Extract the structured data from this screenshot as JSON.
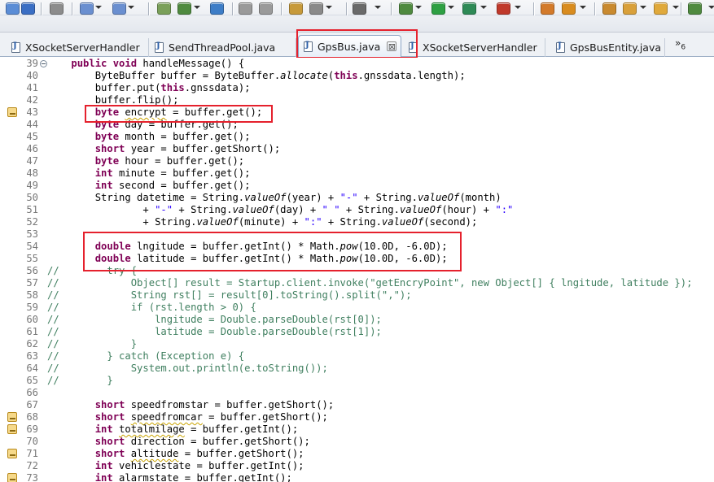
{
  "toolbar": {
    "buttons": [
      {
        "icon": "new-file-icon",
        "color": "#5b8dd6"
      },
      {
        "icon": "save-icon",
        "color": "#3b6fc4"
      },
      {
        "icon": "calendar-icon",
        "color": "#8c8c8c"
      },
      {
        "icon": "hammer-icon",
        "color": "#6a8fd0"
      },
      {
        "icon": "refactor-icon",
        "color": "#6a8fd0"
      },
      {
        "icon": "server-icon",
        "color": "#7aa05a"
      },
      {
        "icon": "deploy-icon",
        "color": "#4f8a3f"
      },
      {
        "icon": "globe-icon",
        "color": "#3d7dc7"
      },
      {
        "icon": "undo-icon",
        "color": "#9a9a9a"
      },
      {
        "icon": "redo-icon",
        "color": "#9a9a9a"
      },
      {
        "icon": "properties-icon",
        "color": "#c79a3a"
      },
      {
        "icon": "web-browser-icon",
        "color": "#8a8a8a"
      },
      {
        "icon": "camera-icon",
        "color": "#6a6a6a"
      },
      {
        "icon": "debug-bug-icon",
        "color": "#4f8a3f"
      },
      {
        "icon": "run-icon",
        "color": "#2ea043"
      },
      {
        "icon": "coverage-icon",
        "color": "#2e8a56"
      },
      {
        "icon": "external-tools-icon",
        "color": "#c0392b"
      },
      {
        "icon": "new-class-icon",
        "color": "#d37a2a"
      },
      {
        "icon": "search-icon",
        "color": "#d98c1f"
      },
      {
        "icon": "open-type-icon",
        "color": "#c98a2f"
      },
      {
        "icon": "edit-pen-icon",
        "color": "#d9a03a"
      },
      {
        "icon": "open-folder-icon",
        "color": "#e0a93b"
      },
      {
        "icon": "pin-icon",
        "color": "#4f8a3f"
      }
    ]
  },
  "tabs": [
    {
      "label": "XSocketServerHandler",
      "active": false
    },
    {
      "label": "SendThreadPool.java",
      "active": false
    },
    {
      "label": "GpsBus.java",
      "active": true,
      "close": "⊠"
    },
    {
      "label": "XSocketServerHandler",
      "active": false
    },
    {
      "label": "GpsBusEntity.java",
      "active": false
    }
  ],
  "tab_overflow": {
    "symbol": "»",
    "count": "6"
  },
  "editor": {
    "lines": [
      {
        "n": "39",
        "fold": true,
        "html": "    <span class=\"kw\">public void</span> handleMessage() {"
      },
      {
        "n": "40",
        "html": "        ByteBuffer buffer = ByteBuffer.<span class=\"ital\">allocate</span>(<span class=\"kw\">this</span>.gnssdata.length);"
      },
      {
        "n": "41",
        "html": "        buffer.put(<span class=\"kw\">this</span>.gnssdata);"
      },
      {
        "n": "42",
        "html": "        buffer.flip();"
      },
      {
        "n": "43",
        "warn": true,
        "html": "        <span class=\"kw\">byte</span> <span class=\"squig\">encrypt</span> = buffer.get();"
      },
      {
        "n": "44",
        "html": "        <span class=\"kw\">byte</span> day = buffer.get();"
      },
      {
        "n": "45",
        "html": "        <span class=\"kw\">byte</span> month = buffer.get();"
      },
      {
        "n": "46",
        "html": "        <span class=\"kw\">short</span> year = buffer.getShort();"
      },
      {
        "n": "47",
        "html": "        <span class=\"kw\">byte</span> hour = buffer.get();"
      },
      {
        "n": "48",
        "html": "        <span class=\"kw\">int</span> minute = buffer.get();"
      },
      {
        "n": "49",
        "html": "        <span class=\"kw\">int</span> second = buffer.get();"
      },
      {
        "n": "50",
        "html": "        String datetime = String.<span class=\"ital\">valueOf</span>(year) + <span class=\"str\">\"-\"</span> + String.<span class=\"ital\">valueOf</span>(month)"
      },
      {
        "n": "51",
        "html": "                + <span class=\"str\">\"-\"</span> + String.<span class=\"ital\">valueOf</span>(day) + <span class=\"str\">\" \"</span> + String.<span class=\"ital\">valueOf</span>(hour) + <span class=\"str\">\":\"</span>"
      },
      {
        "n": "52",
        "html": "                + String.<span class=\"ital\">valueOf</span>(minute) + <span class=\"str\">\":\"</span> + String.<span class=\"ital\">valueOf</span>(second);"
      },
      {
        "n": "53",
        "html": ""
      },
      {
        "n": "54",
        "html": "        <span class=\"kw\">double</span> lngitude = buffer.getInt() * Math.<span class=\"ital\">pow</span>(10.0D, -6.0D);"
      },
      {
        "n": "55",
        "html": "        <span class=\"kw\">double</span> latitude = buffer.getInt() * Math.<span class=\"ital\">pow</span>(10.0D, -6.0D);"
      },
      {
        "n": "56",
        "html": "<span class=\"cm\">//        try {</span>"
      },
      {
        "n": "57",
        "html": "<span class=\"cm\">//            Object[] result = Startup.client.invoke(\"getEncryPoint\", new Object[] { lngitude, latitude });</span>"
      },
      {
        "n": "58",
        "html": "<span class=\"cm\">//            String rst[] = result[0].toString().split(\",\");</span>"
      },
      {
        "n": "59",
        "html": "<span class=\"cm\">//            if (rst.length > 0) {</span>"
      },
      {
        "n": "60",
        "html": "<span class=\"cm\">//                lngitude = Double.parseDouble(rst[0]);</span>"
      },
      {
        "n": "61",
        "html": "<span class=\"cm\">//                latitude = Double.parseDouble(rst[1]);</span>"
      },
      {
        "n": "62",
        "html": "<span class=\"cm\">//            }</span>"
      },
      {
        "n": "63",
        "html": "<span class=\"cm\">//        } catch (Exception e) {</span>"
      },
      {
        "n": "64",
        "html": "<span class=\"cm\">//            System.out.println(e.toString());</span>"
      },
      {
        "n": "65",
        "html": "<span class=\"cm\">//        }</span>"
      },
      {
        "n": "66",
        "html": ""
      },
      {
        "n": "67",
        "html": "        <span class=\"kw\">short</span> speedfromstar = buffer.getShort();"
      },
      {
        "n": "68",
        "warn": true,
        "html": "        <span class=\"kw\">short</span> <span class=\"squig\">speedfromcar</span> = buffer.getShort();"
      },
      {
        "n": "69",
        "warn": true,
        "html": "        <span class=\"kw\">int</span> <span class=\"squig\">totalmilage</span> = buffer.getInt();"
      },
      {
        "n": "70",
        "html": "        <span class=\"kw\">short</span> direction = buffer.getShort();"
      },
      {
        "n": "71",
        "warn": true,
        "html": "        <span class=\"kw\">short</span> <span class=\"squig\">altitude</span> = buffer.getShort();"
      },
      {
        "n": "72",
        "html": "        <span class=\"kw\">int</span> vehiclestate = buffer.getInt();"
      },
      {
        "n": "73",
        "warn": true,
        "html": "        <span class=\"kw\">int</span> alarmstate = buffer.getInt();"
      }
    ]
  }
}
